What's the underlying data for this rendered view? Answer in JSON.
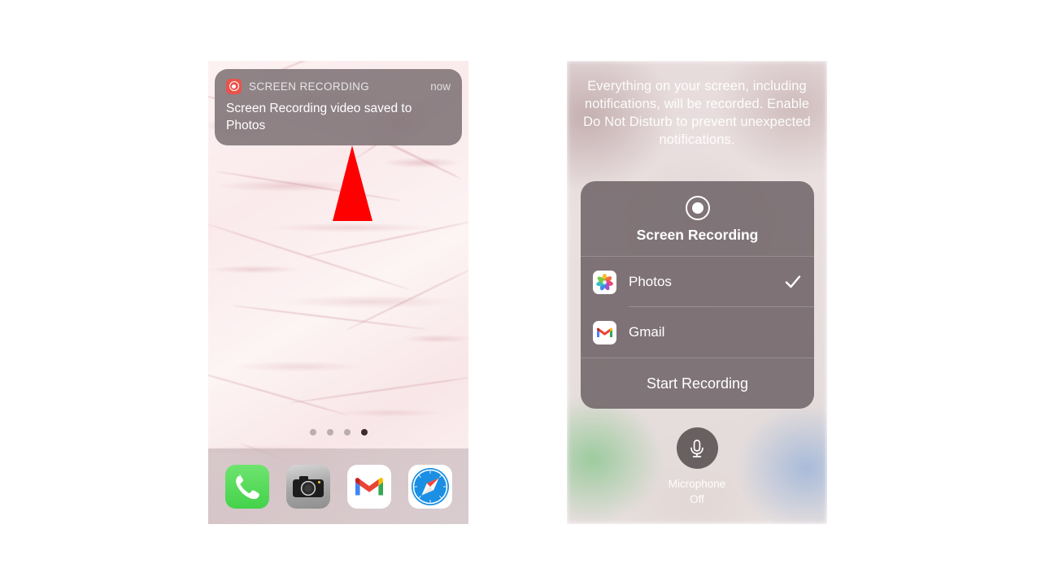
{
  "left_phone": {
    "notification": {
      "app_icon": "screen-recording-icon",
      "app_name": "SCREEN RECORDING",
      "time": "now",
      "message": "Screen Recording video saved to Photos"
    },
    "annotation": {
      "shape": "up-arrow-triangle",
      "color": "#ff0000"
    },
    "home_screen": {
      "page_dots": {
        "count": 4,
        "active_index": 3
      },
      "dock_apps": [
        {
          "name": "Phone",
          "icon": "phone-icon"
        },
        {
          "name": "Camera",
          "icon": "camera-icon"
        },
        {
          "name": "Gmail",
          "icon": "gmail-icon"
        },
        {
          "name": "Safari",
          "icon": "safari-icon"
        }
      ]
    }
  },
  "right_phone": {
    "warning_text": "Everything on your screen, including notifications, will be recorded. Enable Do Not Disturb to prevent unexpected notifications.",
    "control_card": {
      "icon": "record-circle-icon",
      "title": "Screen Recording",
      "destinations": [
        {
          "label": "Photos",
          "icon": "photos-icon",
          "selected": true,
          "check": "checkmark-icon"
        },
        {
          "label": "Gmail",
          "icon": "gmail-icon",
          "selected": false
        }
      ],
      "action_label": "Start Recording"
    },
    "microphone": {
      "icon": "microphone-icon",
      "label_line1": "Microphone",
      "label_line2": "Off"
    }
  },
  "colors": {
    "accent_red": "#e8544a",
    "arrow_red": "#ff0000",
    "card_gray": "#6c6064",
    "banner_gray": "#706468"
  }
}
